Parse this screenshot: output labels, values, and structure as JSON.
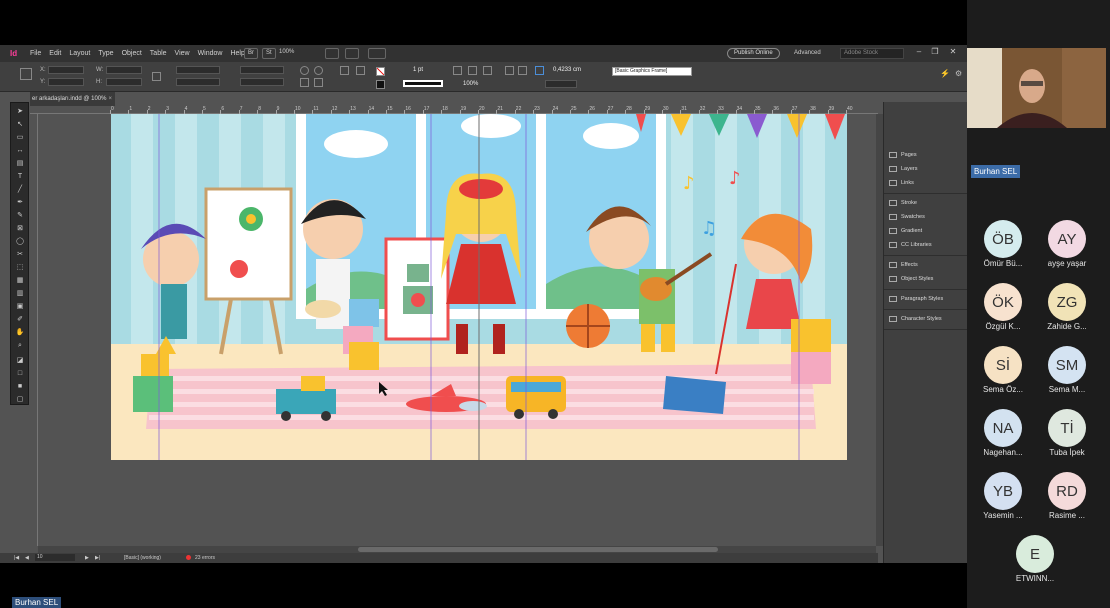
{
  "indesign": {
    "app_logo": "Id",
    "menu": [
      "File",
      "Edit",
      "Layout",
      "Type",
      "Object",
      "Table",
      "View",
      "Window",
      "Help"
    ],
    "bridge_label": "Br",
    "stock_label": "St",
    "zoom": "100%",
    "publish_label": "Publish Online",
    "workspace_label": "Advanced",
    "search_placeholder": "Adobe Stock",
    "control": {
      "x_label": "X:",
      "y_label": "Y:",
      "w_label": "W:",
      "h_label": "H:",
      "stroke_weight": "1 pt",
      "opacity": "100%",
      "dimension": "0,4233 cm",
      "object_style": "[Basic Graphics Frame]"
    },
    "document_tab": "er arkadaşları.indd @ 100%",
    "ruler_numbers": [
      "0",
      "1",
      "2",
      "3",
      "4",
      "5",
      "6",
      "7",
      "8",
      "9",
      "10",
      "11",
      "12",
      "13",
      "14",
      "15",
      "16",
      "17",
      "18",
      "19",
      "20",
      "21",
      "22",
      "23",
      "24",
      "25",
      "26",
      "27",
      "28",
      "29",
      "30",
      "31",
      "32",
      "33",
      "34",
      "35",
      "36",
      "37",
      "38",
      "39",
      "40"
    ],
    "status": {
      "page": "10",
      "style": "[Basic] (working)",
      "errors": "23 errors"
    },
    "panels": [
      {
        "label": "Pages",
        "icon": "pages-icon"
      },
      {
        "label": "Layers",
        "icon": "layers-icon"
      },
      {
        "label": "Links",
        "icon": "links-icon"
      },
      {
        "label": "Stroke",
        "icon": "stroke-icon"
      },
      {
        "label": "Swatches",
        "icon": "swatches-icon"
      },
      {
        "label": "Gradient",
        "icon": "gradient-icon"
      },
      {
        "label": "CC Libraries",
        "icon": "cc-libraries-icon"
      },
      {
        "label": "Effects",
        "icon": "effects-icon"
      },
      {
        "label": "Object Styles",
        "icon": "object-styles-icon"
      },
      {
        "label": "Paragraph Styles",
        "icon": "paragraph-styles-icon"
      },
      {
        "label": "Character Styles",
        "icon": "character-styles-icon"
      }
    ]
  },
  "meeting": {
    "active_speaker": "Burhan SEL",
    "self_label": "Burhan SEL",
    "participants": [
      {
        "initials": "ÖB",
        "name": "Ömür Bü...",
        "color": "#d5ecee"
      },
      {
        "initials": "AY",
        "name": "ayşe yaşar",
        "color": "#f2d9e3"
      },
      {
        "initials": "ÖK",
        "name": "Özgül K...",
        "color": "#f7e2cf"
      },
      {
        "initials": "ZG",
        "name": "Zahide G...",
        "color": "#f1e3b7"
      },
      {
        "initials": "Sİ",
        "name": "Sema Öz...",
        "color": "#f6e2c4"
      },
      {
        "initials": "SM",
        "name": "Sema M...",
        "color": "#d4e3f2"
      },
      {
        "initials": "NA",
        "name": "Nagehan...",
        "color": "#d3e2f0"
      },
      {
        "initials": "Tİ",
        "name": "Tuba İpek",
        "color": "#dfe8df"
      },
      {
        "initials": "YB",
        "name": "Yasemin ...",
        "color": "#d4e0f1"
      },
      {
        "initials": "RD",
        "name": "Rasime ...",
        "color": "#f4dada"
      },
      {
        "initials": "E",
        "name": "ETWINN...",
        "color": "#d9ecdc"
      }
    ]
  }
}
